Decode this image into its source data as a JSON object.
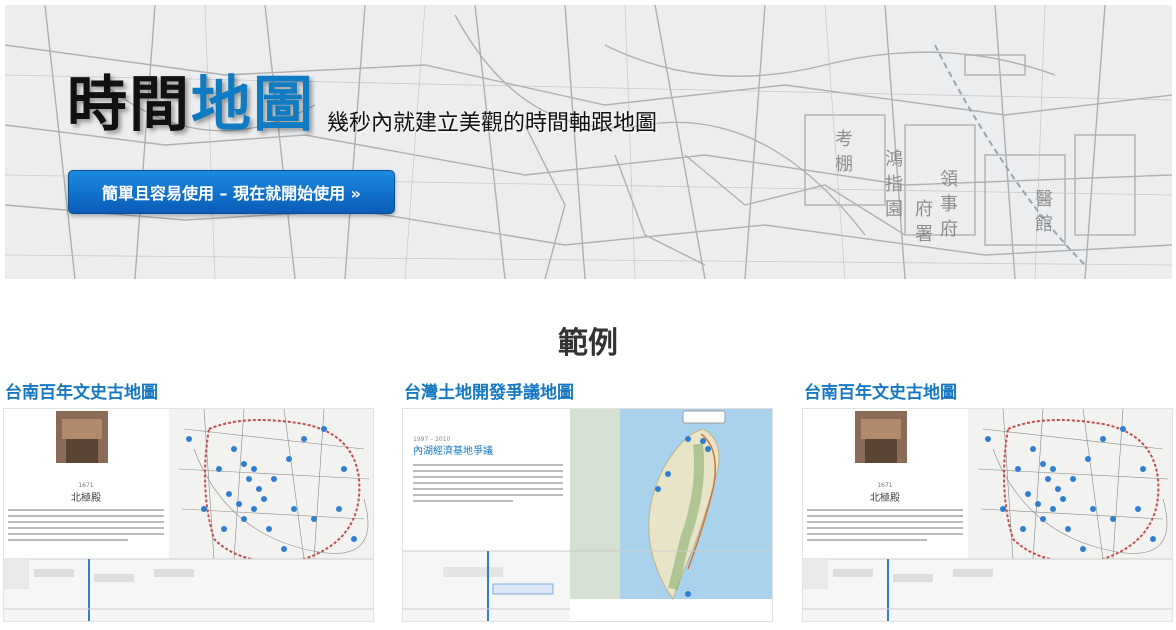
{
  "hero": {
    "title_part1": "時間",
    "title_part2": "地圖",
    "subtitle": "幾秒內就建立美觀的時間軸跟地圖",
    "cta_label": "簡單且容易使用 – 現在就開始使用 »"
  },
  "examples": {
    "heading": "範例",
    "cards": [
      {
        "title": "台南百年文史古地圖",
        "panel_title": "北極殿",
        "panel_year": "1671"
      },
      {
        "title": "台灣土地開發爭議地圖",
        "panel_title": "內湖經濟基地爭議",
        "panel_year": "1997 – 2010"
      },
      {
        "title": "台南百年文史古地圖",
        "panel_title": "北極殿",
        "panel_year": "1671"
      }
    ]
  },
  "colors": {
    "accent": "#1778c2",
    "button": "#0a5cb8",
    "marker": "#2f7fd0"
  }
}
